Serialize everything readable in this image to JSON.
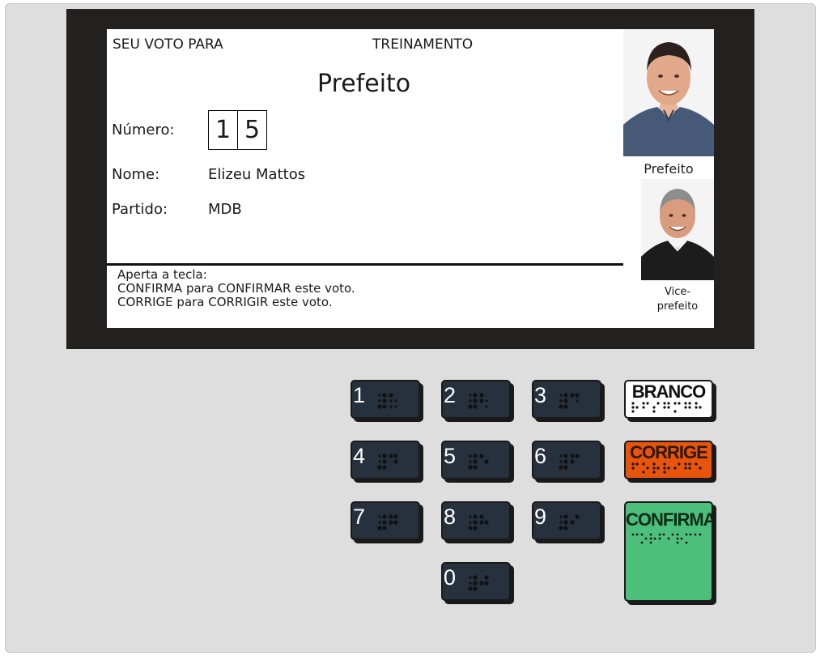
{
  "screen": {
    "header_left": "SEU VOTO PARA",
    "header_center": "TREINAMENTO",
    "office": "Prefeito",
    "numero_label": "Número:",
    "digits": [
      "1",
      "5"
    ],
    "nome_label": "Nome:",
    "nome_value": "Elizeu Mattos",
    "partido_label": "Partido:",
    "partido_value": "MDB",
    "instructions": [
      "Aperta a tecla:",
      "CONFIRMA para CONFIRMAR este voto.",
      "CORRIGE para CORRIGIR este voto."
    ],
    "photo_main_caption": "Prefeito",
    "photo_vice_caption_line1": "Vice-",
    "photo_vice_caption_line2": "prefeito"
  },
  "keypad": {
    "keys": [
      "1",
      "2",
      "3",
      "4",
      "5",
      "6",
      "7",
      "8",
      "9",
      "0"
    ],
    "branco_label": "BRANCO",
    "corrige_label": "CORRIGE",
    "confirma_label": "CONFIRMA"
  },
  "colors": {
    "branco": "#ffffff",
    "corrige": "#e9540d",
    "confirma": "#4cc07a",
    "numeric_key": "#27303d",
    "bezel": "#232020",
    "body": "#dedede"
  }
}
